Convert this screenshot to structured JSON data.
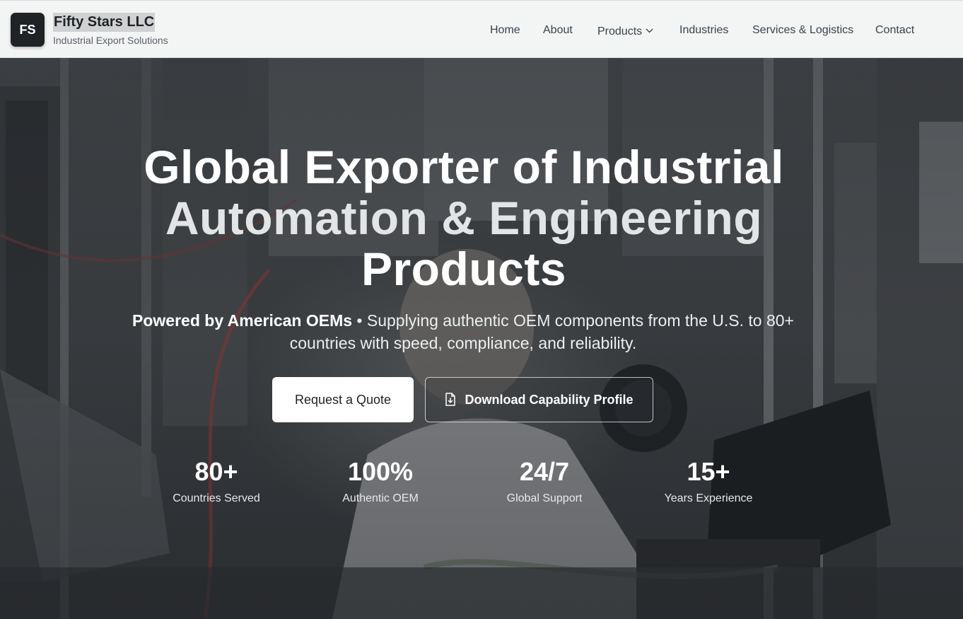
{
  "header": {
    "logo_initials": "FS",
    "brand_name": "Fifty Stars LLC",
    "brand_tagline": "Industrial Export Solutions",
    "nav": [
      {
        "label": "Home"
      },
      {
        "label": "About"
      },
      {
        "label": "Products"
      },
      {
        "label": "Industries"
      },
      {
        "label": "Services & Logistics"
      },
      {
        "label": "Contact"
      }
    ]
  },
  "hero": {
    "headline_line1": "Global Exporter of Industrial",
    "headline_line2": "Automation & Engineering",
    "headline_line3": "Products",
    "sub_strong": "Powered by American OEMs",
    "sub_rest": " • Supplying authentic OEM components from the U.S. to 80+ countries with speed, compliance, and reliability.",
    "primary_button": "Request a Quote",
    "secondary_button": "Download Capability Profile",
    "stats": [
      {
        "value": "80+",
        "label": "Countries Served"
      },
      {
        "value": "100%",
        "label": "Authentic OEM"
      },
      {
        "value": "24/7",
        "label": "Global Support"
      },
      {
        "value": "15+",
        "label": "Years Experience"
      }
    ]
  }
}
